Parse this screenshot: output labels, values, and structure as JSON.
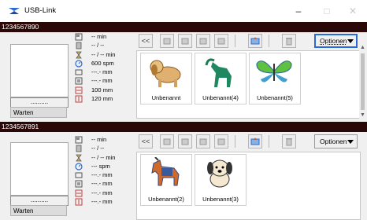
{
  "window": {
    "title": "USB-Link",
    "minimize": "–",
    "maximize": "□",
    "close": "✕"
  },
  "panels": [
    {
      "id": "1234567890",
      "button_label": "..........",
      "status": "Warten",
      "stats": {
        "time1": "-- min",
        "count": "-- / --",
        "time2": "-- / -- min",
        "speed": "600 spm",
        "dim1": "---.- mm",
        "dim2": "---.- mm",
        "width": "100 mm",
        "height": "120 mm"
      },
      "toolbar": {
        "collapse": "<<",
        "options": "Optionen"
      },
      "designs": [
        {
          "label": "Unbenannt",
          "icon": "dog-embroidery-icon"
        },
        {
          "label": "Unbenannt(4)",
          "icon": "ibex-embroidery-icon"
        },
        {
          "label": "Unbenannt(5)",
          "icon": "butterfly-embroidery-icon"
        }
      ]
    },
    {
      "id": "1234567891",
      "button_label": "..........",
      "status": "Warten",
      "stats": {
        "time1": "-- min",
        "count": "-- / --",
        "time2": "-- / -- min",
        "speed": "--- spm",
        "dim1": "---.- mm",
        "dim2": "---.- mm",
        "width": "---.- mm",
        "height": "---.- mm"
      },
      "toolbar": {
        "collapse": "<<",
        "options": "Optionen"
      },
      "designs": [
        {
          "label": "Unbenannt(2)",
          "icon": "horse-embroidery-icon"
        },
        {
          "label": "Unbenannt(3)",
          "icon": "puppy-embroidery-icon"
        }
      ]
    }
  ],
  "colors": {
    "header": "#2b0808",
    "focus": "#2a6ad6"
  }
}
